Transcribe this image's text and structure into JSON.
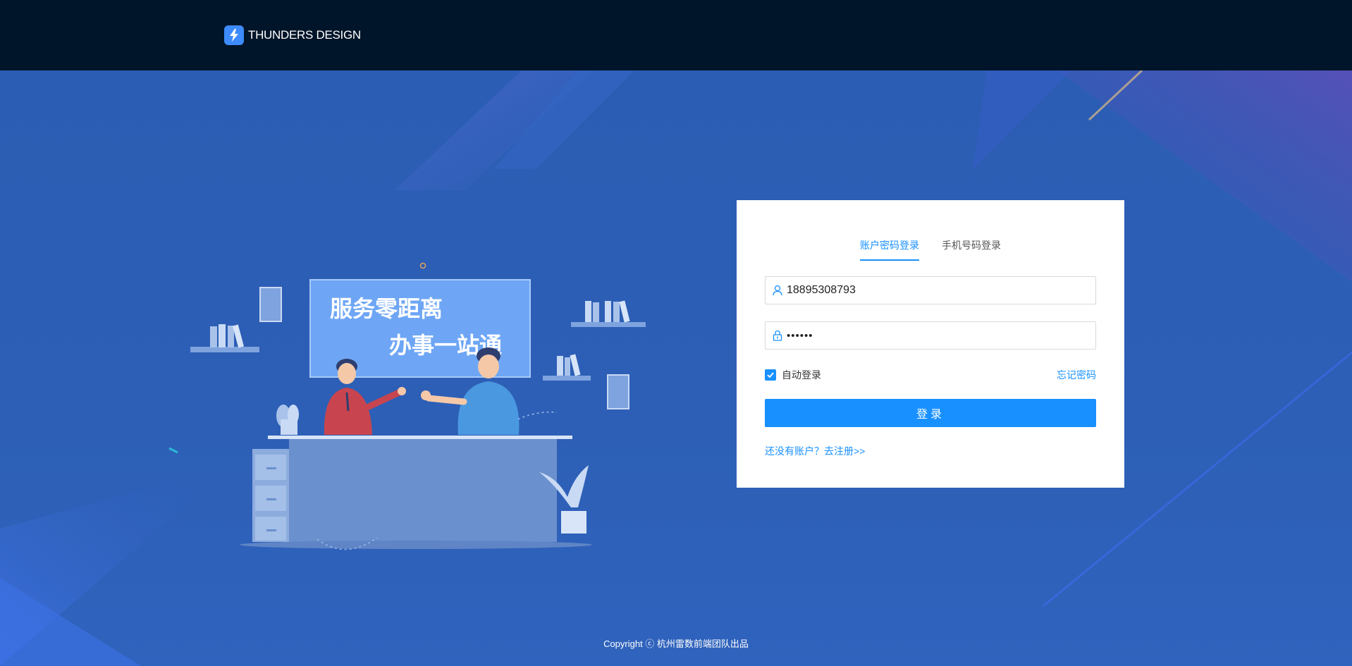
{
  "header": {
    "brand_name": "THUNDERS DESIGN",
    "logo_icon": "lightning-bolt-icon"
  },
  "illustration": {
    "banner_line1": "服务零距离",
    "banner_line2": "办事一站通"
  },
  "login": {
    "tabs": [
      {
        "label": "账户密码登录",
        "active": true
      },
      {
        "label": "手机号码登录",
        "active": false
      }
    ],
    "username": {
      "value": "18895308793",
      "icon": "user-icon"
    },
    "password": {
      "value": "••••••",
      "icon": "lock-icon"
    },
    "auto_login": {
      "label": "自动登录",
      "checked": true
    },
    "forgot_label": "忘记密码",
    "submit_label": "登录",
    "register_label": "还没有账户？去注册>>"
  },
  "footer": {
    "copyright": "Copyright ⓒ 杭州雷数前端团队出品"
  },
  "colors": {
    "header_bg": "#001529",
    "page_bg": "#2d5fb1",
    "accent": "#1890ff"
  }
}
